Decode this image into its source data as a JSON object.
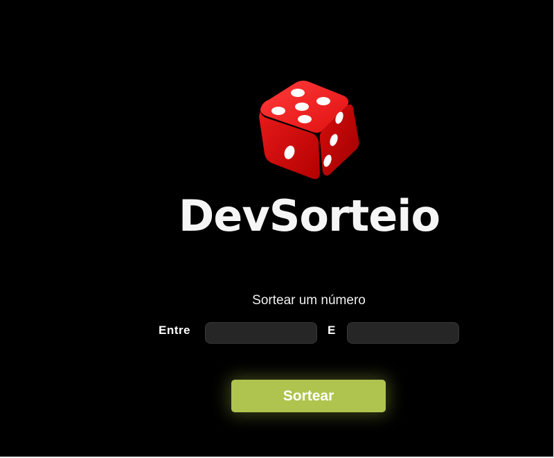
{
  "app": {
    "brand_name": "DevSorteio",
    "logo_icon": "red-dice-icon"
  },
  "form": {
    "subtitle": "Sortear um número",
    "from_label": "Entre",
    "from_value": "",
    "to_label": "E",
    "to_value": "",
    "submit_label": "Sortear"
  },
  "colors": {
    "background": "#000000",
    "button": "#afc44e",
    "input_background": "#262626",
    "dice_red": "#e0121b"
  }
}
